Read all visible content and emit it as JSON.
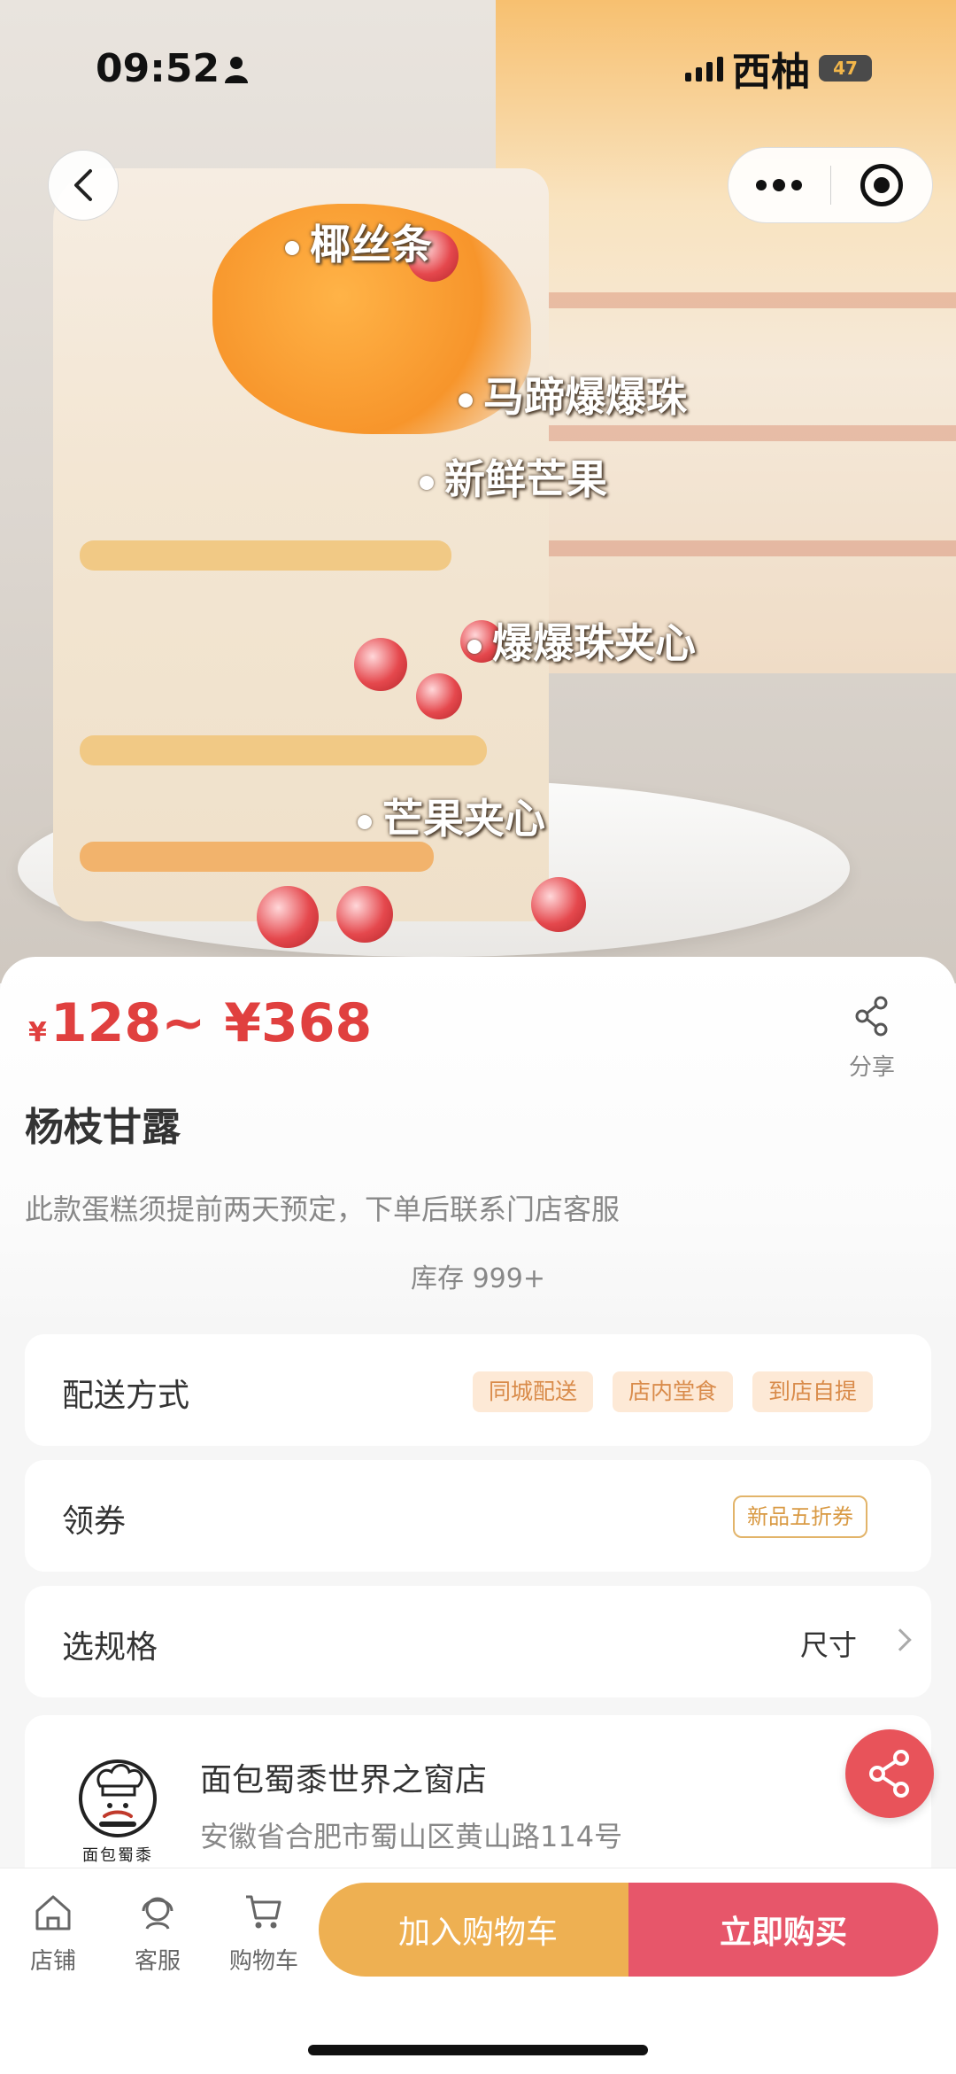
{
  "status_bar": {
    "time": "09:52",
    "carrier": "西柚",
    "battery": "47"
  },
  "hero_labels": [
    "椰丝条",
    "马蹄爆爆珠",
    "新鲜芒果",
    "爆爆珠夹心",
    "芒果夹心"
  ],
  "product": {
    "currency": "¥",
    "price_range": "128~ ¥368",
    "share_label": "分享",
    "title": "杨枝甘露",
    "description": "此款蛋糕须提前两天预定，下单后联系门店客服",
    "stock": "库存 999+"
  },
  "delivery": {
    "label": "配送方式",
    "options": [
      "同城配送",
      "店内堂食",
      "到店自提"
    ]
  },
  "coupon": {
    "label": "领券",
    "tag": "新品五折券"
  },
  "spec": {
    "label": "选规格",
    "value": "尺寸"
  },
  "store": {
    "logo_text": "面包蜀黍",
    "name": "面包蜀黍世界之窗店",
    "address": "安徽省合肥市蜀山区黄山路114号"
  },
  "bottom_nav": {
    "store": "店铺",
    "service": "客服",
    "cart": "购物车"
  },
  "actions": {
    "add_to_cart": "加入购物车",
    "buy_now": "立即购买"
  },
  "colors": {
    "price": "#e0403f",
    "cart_button": "#eeb052",
    "buy_button": "#e7566a",
    "tag_bg": "#fde9d6"
  },
  "icons": [
    "person-icon",
    "signal-icon",
    "back-chevron-icon",
    "more-dots-icon",
    "target-icon",
    "share-icon",
    "chevron-right-icon",
    "home-icon",
    "customer-service-icon",
    "cart-icon"
  ]
}
